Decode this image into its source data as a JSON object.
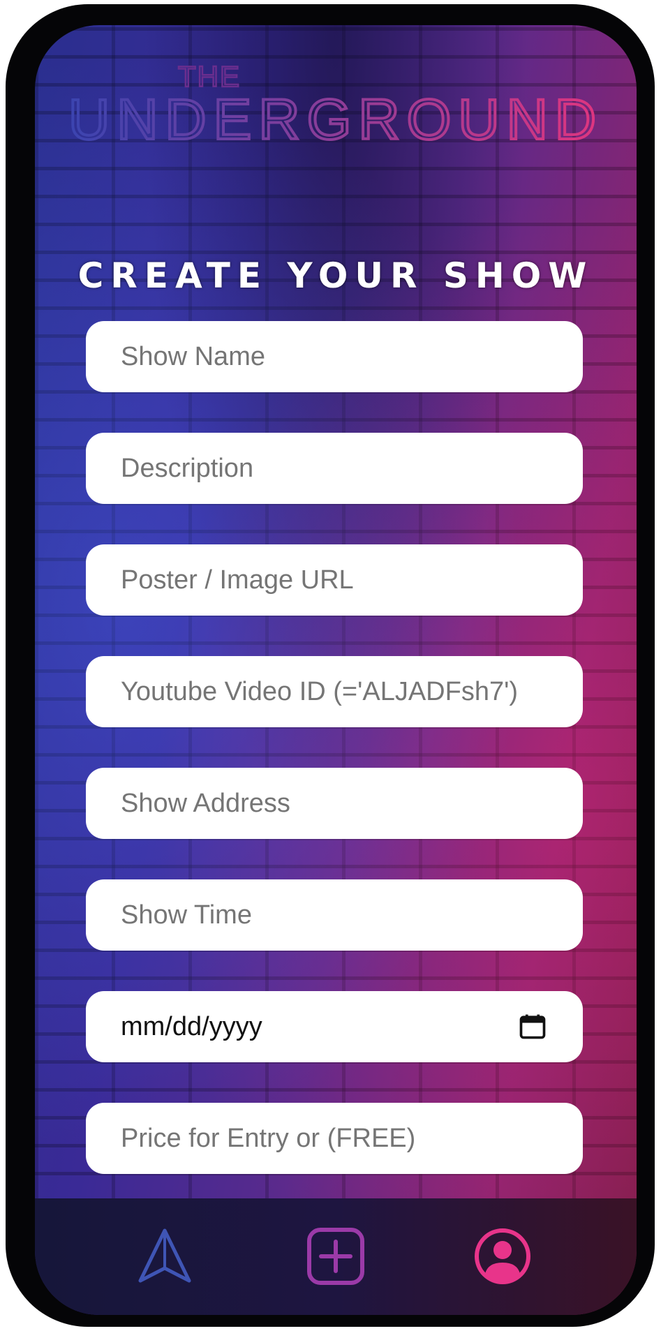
{
  "app": {
    "logo_small": "THE",
    "logo_big": "UNDERGROUND"
  },
  "page": {
    "title": "CREATE YOUR SHOW"
  },
  "form": {
    "show_name_placeholder": "Show Name",
    "description_placeholder": "Description",
    "poster_url_placeholder": "Poster / Image URL",
    "youtube_id_placeholder": "Youtube Video ID (='ALJADFsh7')",
    "address_placeholder": "Show Address",
    "time_placeholder": "Show Time",
    "date_value": "mm/dd/yyyy",
    "price_placeholder": "Price for Entry or (FREE)"
  },
  "nav": {
    "items": [
      {
        "icon": "navigate-arrow-icon",
        "color": "#3f55b5"
      },
      {
        "icon": "add-square-icon",
        "color": "#9b3aa8"
      },
      {
        "icon": "user-profile-icon",
        "color": "#e8348a"
      }
    ]
  },
  "colors": {
    "logo_gradient_start": "#3b44b0",
    "logo_gradient_end": "#e0357f",
    "title_text": "#ffffff",
    "field_background": "#ffffff",
    "placeholder_text": "#757575"
  }
}
